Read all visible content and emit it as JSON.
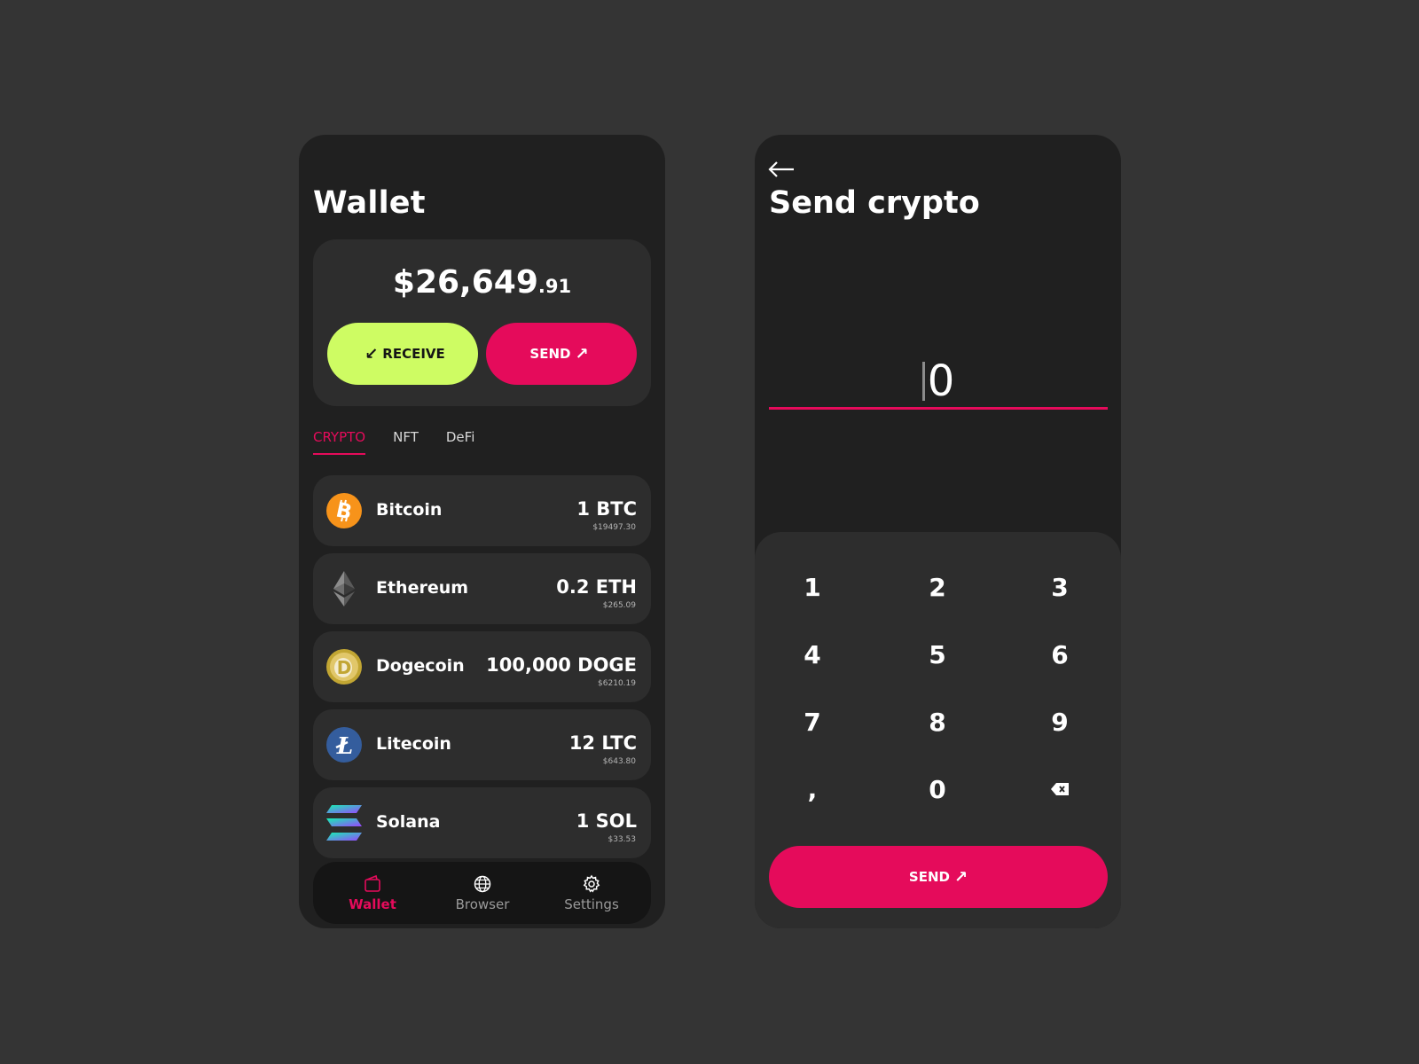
{
  "colors": {
    "background": "#343434",
    "panel": "#202020",
    "card": "#2d2d2d",
    "accent_pink": "#e50b5b",
    "accent_lime": "#cefc63"
  },
  "wallet": {
    "title": "Wallet",
    "balance_main": "$26,649",
    "balance_cents": ".91",
    "receive_label": "RECEIVE",
    "receive_arrow": "↙",
    "send_label": "SEND",
    "send_arrow": "↗",
    "tabs": [
      {
        "label": "CRYPTO",
        "active": true
      },
      {
        "label": "NFT",
        "active": false
      },
      {
        "label": "DeFi",
        "active": false
      }
    ],
    "coins": [
      {
        "name": "Bitcoin",
        "amount": "1 BTC",
        "usd": "$19497.30",
        "icon": "bitcoin-icon"
      },
      {
        "name": "Ethereum",
        "amount": "0.2 ETH",
        "usd": "$265.09",
        "icon": "ethereum-icon"
      },
      {
        "name": "Dogecoin",
        "amount": "100,000 DOGE",
        "usd": "$6210.19",
        "icon": "dogecoin-icon"
      },
      {
        "name": "Litecoin",
        "amount": "12 LTC",
        "usd": "$643.80",
        "icon": "litecoin-icon"
      },
      {
        "name": "Solana",
        "amount": "1 SOL",
        "usd": "$33.53",
        "icon": "solana-icon"
      }
    ],
    "nav": [
      {
        "label": "Wallet",
        "icon": "wallet-icon",
        "active": true
      },
      {
        "label": "Browser",
        "icon": "globe-icon",
        "active": false
      },
      {
        "label": "Settings",
        "icon": "gear-icon",
        "active": false
      }
    ]
  },
  "send": {
    "title": "Send crypto",
    "amount": "0",
    "keys": [
      "1",
      "2",
      "3",
      "4",
      "5",
      "6",
      "7",
      "8",
      "9",
      ",",
      "0"
    ],
    "backspace_icon": "backspace-icon",
    "button_label": "SEND",
    "button_arrow": "↗"
  }
}
